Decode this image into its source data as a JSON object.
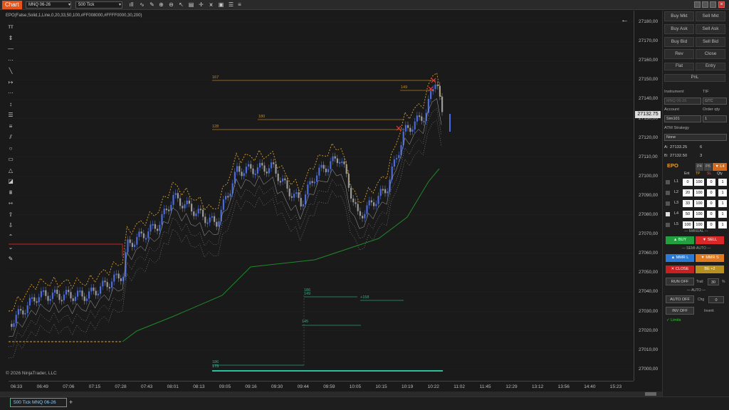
{
  "window": {
    "chart_label": "Chart",
    "instrument": "MNQ 06-26",
    "period": "500 Tick"
  },
  "toolbar_icons": [
    "bar-chart-icon",
    "line-icon",
    "pencil-icon",
    "zoom-icon",
    "zoom-out-icon",
    "cursor-icon",
    "data-box-icon",
    "crosshair-icon",
    "indicator-icon",
    "strategy-icon",
    "properties-icon",
    "list-icon"
  ],
  "chart": {
    "indicator_label": "EPO(False,Solid,1,Line,0,20,33,50,100,#FF008000,#FFFF0000,30,200)",
    "copyright": "© 2026 NinjaTrader, LLC",
    "back_arrow": "←",
    "last_price": "27132.75",
    "y_ticks": [
      "27180,00",
      "27170,00",
      "27160,00",
      "27150,00",
      "27140,00",
      "27130,00",
      "27120,00",
      "27110,00",
      "27100,00",
      "27090,00",
      "27080,00",
      "27070,00",
      "27060,00",
      "27050,00",
      "27040,00",
      "27030,00",
      "27020,00",
      "27010,00",
      "27000,00"
    ],
    "x_ticks": [
      "06:33",
      "06:49",
      "07:06",
      "07:15",
      "07:28",
      "07:43",
      "08:01",
      "08:13",
      "09:05",
      "09:16",
      "09:30",
      "09:44",
      "09:59",
      "10:05",
      "10:15",
      "10:19",
      "10:22",
      "11:02",
      "11:45",
      "12:29",
      "13:12",
      "13:56",
      "14:40",
      "15:23"
    ],
    "annotations": [
      {
        "text": "167"
      },
      {
        "text": "149"
      },
      {
        "text": "180"
      },
      {
        "text": "128"
      },
      {
        "text": "186"
      },
      {
        "text": "149"
      },
      {
        "text": "+158"
      },
      {
        "text": "145"
      },
      {
        "text": "186"
      },
      {
        "text": "175"
      },
      {
        "text": "175"
      }
    ]
  },
  "panel": {
    "buy_mkt": "Buy Mkt",
    "sell_mkt": "Sell Mkt",
    "buy_ask": "Buy Ask",
    "sell_ask": "Sell Ask",
    "buy_bid": "Buy Bid",
    "sell_bid": "Sell Bid",
    "rev": "Rev",
    "close": "Close",
    "flat": "Flat",
    "entry": "Entry",
    "pnl": "PnL",
    "instrument_label": "Instrument",
    "tif_label": "TIF",
    "instrument_value": "MNQ 06-26",
    "tif_value": "GTC",
    "account_label": "Account",
    "qty_label": "Order qty",
    "account_value": "Sim101",
    "qty_value": "1",
    "atm_label": "ATM Strategy",
    "atm_value": "None",
    "ask_label": "A:",
    "ask_value": "27133.25",
    "ask_size": "6",
    "bid_label": "B:",
    "bid_value": "27132.50",
    "bid_size": "3",
    "epo_title": "EPO",
    "tab_a": "P4",
    "tab_b": "P6",
    "tab_c": "▼ L4",
    "grid_headers": [
      "Ent",
      "TP",
      "SL",
      "Qty"
    ],
    "grid_rows": [
      {
        "label": "L1",
        "ent": "0",
        "tp": "100",
        "sl": "0",
        "qty": "1",
        "checked": false
      },
      {
        "label": "L2",
        "ent": "20",
        "tp": "100",
        "sl": "0",
        "qty": "1",
        "checked": false
      },
      {
        "label": "L3",
        "ent": "33",
        "tp": "100",
        "sl": "0",
        "qty": "1",
        "checked": false
      },
      {
        "label": "L4",
        "ent": "50",
        "tp": "100",
        "sl": "0",
        "qty": "1",
        "checked": true
      },
      {
        "label": "L5",
        "ent": "100",
        "tp": "100",
        "sl": "0",
        "qty": "1",
        "checked": false
      }
    ],
    "manual_label": "— MANUAL —",
    "buy": "▲ BUY",
    "sell": "▼ SELL",
    "semi_label": "— SEMI-AUTO —",
    "mmr_l": "▲ MMR L",
    "mmr_s": "▼ MMR S",
    "close_btn": "✕ CLOSE",
    "be_btn": "BE +2",
    "run_btn": "RUN OFF",
    "trail_label": "Trail",
    "trail_value": "30",
    "pct": "%",
    "auto_label": "— AUTO —",
    "auto_btn": "AUTO OFF",
    "chg_label": "Chg",
    "chg_value": "0",
    "inv_btn": "INV OFF",
    "inverti_label": "Inverti",
    "limits": "✓ Limits"
  },
  "tabs": {
    "active": "500 Tick MNQ 06-26",
    "add": "+"
  },
  "colors": {
    "accent": "#e8531c",
    "up": "#4b6bd6",
    "down": "#9a9a9a",
    "stop_green": "#1f8a2a",
    "orange": "#d9a030",
    "red": "#cc2222"
  }
}
